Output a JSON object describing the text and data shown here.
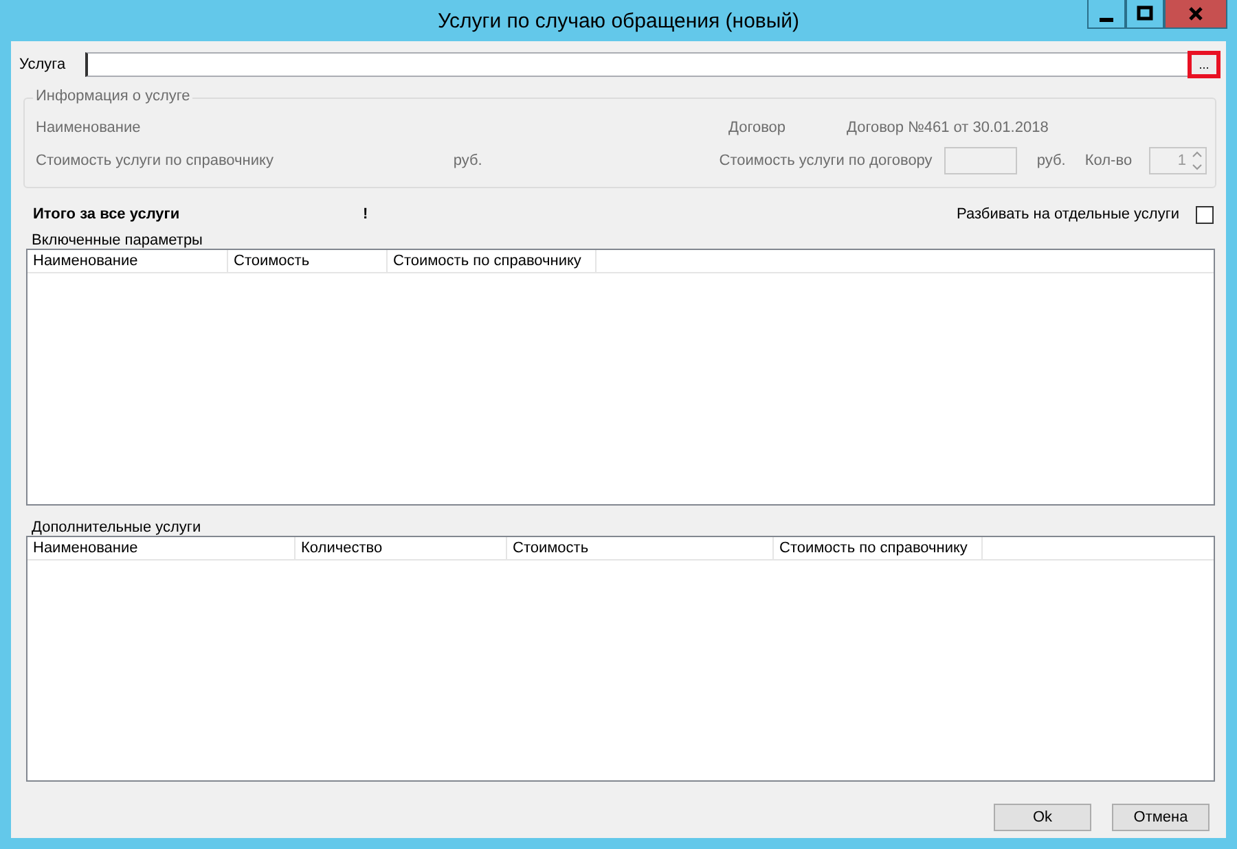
{
  "window": {
    "title": "Услуги по случаю обращения (новый)"
  },
  "service": {
    "label": "Услуга",
    "browse": "..."
  },
  "service_info": {
    "legend": "Информация о услуге",
    "name_label": "Наименование",
    "contract_label": "Договор",
    "contract_value": "Договор №461 от 30.01.2018",
    "catalog_price_label": "Стоимость услуги по справочнику",
    "catalog_price_unit": "руб.",
    "contract_price_label": "Стоимость услуги по договору",
    "contract_price_unit": "руб.",
    "quantity_label": "Кол-во",
    "quantity": {
      "value": "1",
      "disabled": true
    }
  },
  "total": {
    "label": "Итого за все услуги",
    "value": "!"
  },
  "split": {
    "label": "Разбивать на отдельные услуги",
    "checked": false
  },
  "included": {
    "legend": "Включенные параметры",
    "columns": [
      "Наименование",
      "Стоимость",
      "Стоимость по справочнику"
    ]
  },
  "additional": {
    "legend": "Дополнительные услуги",
    "columns": [
      "Наименование",
      "Количество",
      "Стоимость",
      "Стоимость по справочнику"
    ]
  },
  "buttons": [
    "Ok",
    "Отмена"
  ]
}
